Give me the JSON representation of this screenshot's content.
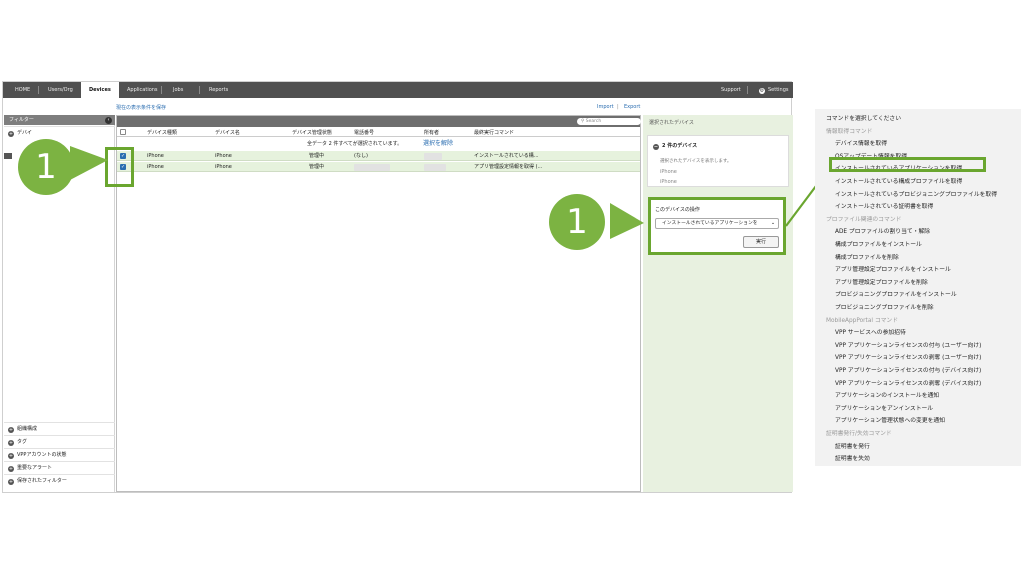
{
  "nav": {
    "tabs": [
      "HOME",
      "Users/Org",
      "Devices",
      "Applications",
      "Jobs",
      "Reports"
    ],
    "active": "Devices",
    "support": "Support",
    "settings": "Settings"
  },
  "toolbar": {
    "save_filter": "現在の表示条件を保存",
    "import": "Import",
    "separator": "|",
    "export": "Export"
  },
  "sidebar": {
    "title": "フィルター",
    "top_item": "デバイ",
    "bottom_items": [
      "組織構成",
      "タグ",
      "VPPアカウントの状態",
      "重要なアラート",
      "保存されたフィルター"
    ]
  },
  "table": {
    "search_placeholder": "Search",
    "headers": [
      "デバイス種類",
      "デバイス名",
      "デバイス管理状態",
      "電話番号",
      "所有者",
      "最終実行コマンド"
    ],
    "select_all_text": "全データ 2 件すべてが選択されています。",
    "clear_selection": "選択を解除",
    "rows": [
      {
        "type": "iPhone",
        "name": "iPhone",
        "state": "管理中",
        "phone": "(なし)",
        "last_command": "インストールされている構..."
      },
      {
        "type": "iPhone",
        "name": "iPhone",
        "state": "管理中",
        "phone": "",
        "last_command": "アプリ管理設定情報を取得 (..."
      }
    ]
  },
  "right_panel": {
    "title": "選択されたデバイス",
    "count_label": "2 件のデバイス",
    "hint": "選択されたデバイスを表示します。",
    "devices": [
      "iPhone",
      "iPhone"
    ],
    "ops_title": "このデバイスの操作",
    "selected_command": "インストールされているアプリケーションを",
    "run_button": "実行"
  },
  "callouts": [
    "1",
    "1"
  ],
  "menu": {
    "items": [
      {
        "text": "コマンドを選択してください",
        "kind": "item",
        "indent": 0
      },
      {
        "text": "情報取得コマンド",
        "kind": "header",
        "indent": 0
      },
      {
        "text": "デバイス情報を取得",
        "kind": "item",
        "indent": 1
      },
      {
        "text": "OSアップデート情報を取得",
        "kind": "item",
        "indent": 1
      },
      {
        "text": "インストールされているアプリケーションを取得",
        "kind": "item",
        "indent": 1,
        "highlight": true
      },
      {
        "text": "インストールされている構成プロファイルを取得",
        "kind": "item",
        "indent": 1
      },
      {
        "text": "インストールされているプロビジョニングプロファイルを取得",
        "kind": "item",
        "indent": 1
      },
      {
        "text": "インストールされている証明書を取得",
        "kind": "item",
        "indent": 1
      },
      {
        "text": "プロファイル関連のコマンド",
        "kind": "header",
        "indent": 0
      },
      {
        "text": "ADE プロファイルの割り当て・解除",
        "kind": "item",
        "indent": 1
      },
      {
        "text": "構成プロファイルをインストール",
        "kind": "item",
        "indent": 1
      },
      {
        "text": "構成プロファイルを削除",
        "kind": "item",
        "indent": 1
      },
      {
        "text": "アプリ管理設定プロファイルをインストール",
        "kind": "item",
        "indent": 1
      },
      {
        "text": "アプリ管理設定プロファイルを削除",
        "kind": "item",
        "indent": 1
      },
      {
        "text": "プロビジョニングプロファイルをインストール",
        "kind": "item",
        "indent": 1
      },
      {
        "text": "プロビジョニングプロファイルを削除",
        "kind": "item",
        "indent": 1
      },
      {
        "text": "MobileAppPortal コマンド",
        "kind": "header",
        "indent": 0
      },
      {
        "text": "VPP サービスへの参加招待",
        "kind": "item",
        "indent": 1
      },
      {
        "text": "VPP アプリケーションライセンスの付与 (ユーザー向け)",
        "kind": "item",
        "indent": 1
      },
      {
        "text": "VPP アプリケーションライセンスの剥奪 (ユーザー向け)",
        "kind": "item",
        "indent": 1
      },
      {
        "text": "VPP アプリケーションライセンスの付与 (デバイス向け)",
        "kind": "item",
        "indent": 1
      },
      {
        "text": "VPP アプリケーションライセンスの剥奪 (デバイス向け)",
        "kind": "item",
        "indent": 1
      },
      {
        "text": "アプリケーションのインストールを通知",
        "kind": "item",
        "indent": 1
      },
      {
        "text": "アプリケーションをアンインストール",
        "kind": "item",
        "indent": 1
      },
      {
        "text": "アプリケーション管理状態への変更を通知",
        "kind": "item",
        "indent": 1
      },
      {
        "text": "証明書発行/失効コマンド",
        "kind": "header",
        "indent": 0
      },
      {
        "text": "証明書を発行",
        "kind": "item",
        "indent": 1
      },
      {
        "text": "証明書を失効",
        "kind": "item",
        "indent": 1
      }
    ]
  },
  "colors": {
    "highlight": "#6aa62f",
    "callout": "#7cb342",
    "link": "#2a6db0",
    "nav": "#505050"
  }
}
